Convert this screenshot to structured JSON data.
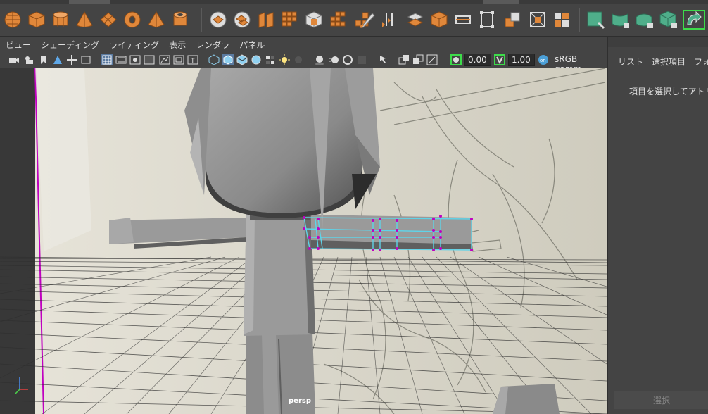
{
  "viewport_menu": [
    "ビュー",
    "シェーディング",
    "ライティング",
    "表示",
    "レンダラ",
    "パネル"
  ],
  "toolbar": {
    "exposure_value": "0.00",
    "gamma_value": "1.00",
    "colorspace_label": "sRGB gamm"
  },
  "viewport": {
    "camera_label": "persp"
  },
  "right_panel": {
    "tabs": [
      "リスト",
      "選択項目",
      "フォー"
    ],
    "message": "項目を選択してアトリビュ",
    "select_button": "選択"
  },
  "colors": {
    "shelf_icon_orange": "#e0873a",
    "shelf_icon_green": "#4fae8a",
    "highlight_green": "#3ddc4a",
    "selection_cyan": "#5fd3e8",
    "vertex_magenta": "#c000c0"
  },
  "icons": {
    "shelf": [
      "poly-sphere-icon",
      "poly-cube-icon",
      "poly-cylinder-icon",
      "poly-cone-icon",
      "poly-plane-icon",
      "poly-torus-icon",
      "poly-pyramid-icon",
      "poly-pipe-icon",
      "combine-icon",
      "separate-icon",
      "extract-icon",
      "smooth-icon",
      "boolean-icon",
      "mirror-icon",
      "bevel-icon",
      "bridge-icon",
      "multicut-icon",
      "extrude-icon",
      "append-icon",
      "merge-icon",
      "target-weld-icon",
      "planar-map-icon",
      "auto-map-icon",
      "uv-editor-icon",
      "layout-icon",
      "unfold-icon",
      "sew-icon",
      "cut-uv-icon",
      "modeling-toolkit-icon"
    ]
  }
}
